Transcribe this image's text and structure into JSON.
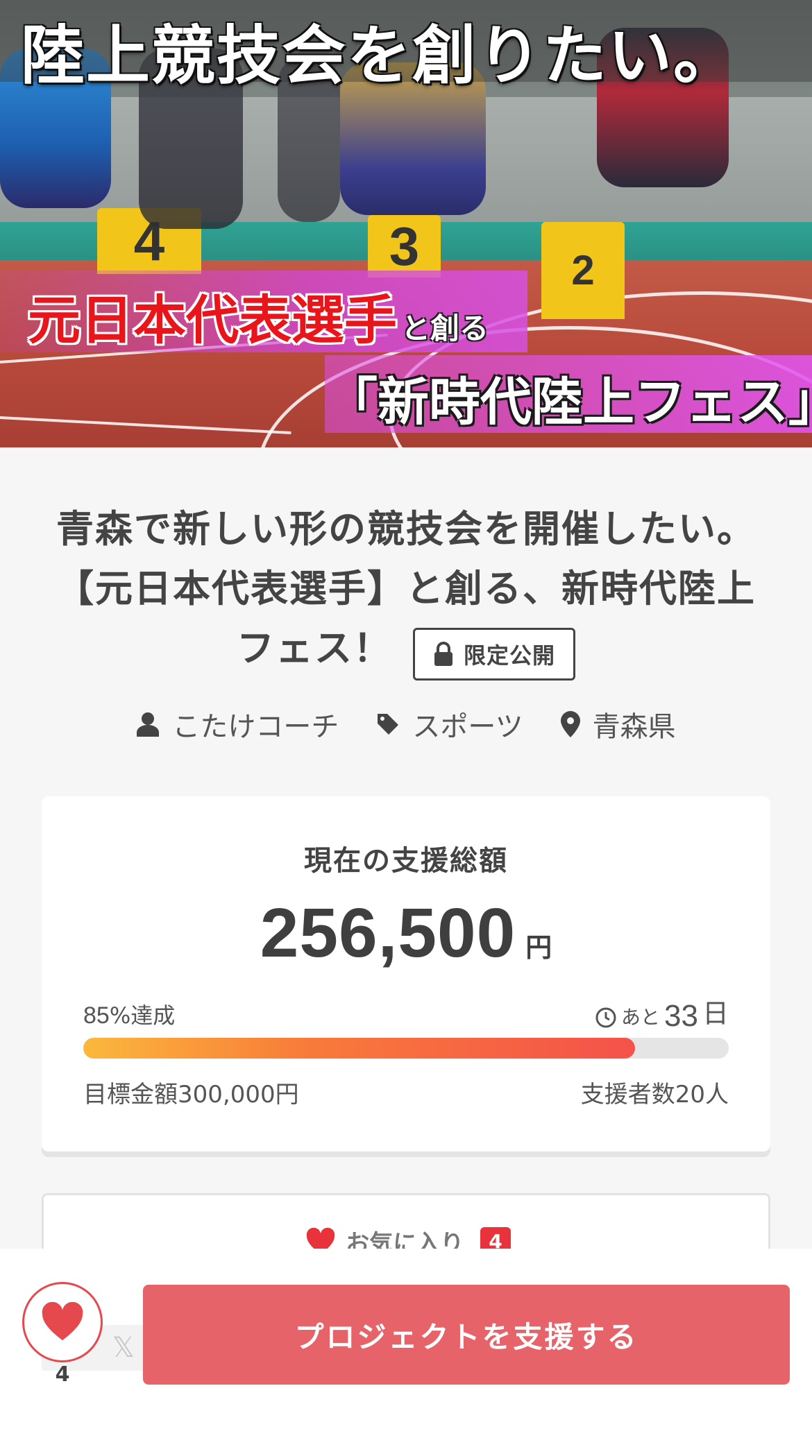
{
  "hero": {
    "headline": "陸上競技会を創りたい。",
    "sub_big": "元日本代表選手",
    "sub_small": "と創る",
    "fes": "「新時代陸上フェス」"
  },
  "project": {
    "title": "青森で新しい形の競技会を開催したい。【元日本代表選手】と創る、新時代陸上フェス！",
    "limited_label": "限定公開",
    "owner": "こたけコーチ",
    "category": "スポーツ",
    "location": "青森県"
  },
  "funding": {
    "label": "現在の支援総額",
    "amount": "256,500",
    "currency_unit": "円",
    "percent": "85",
    "percent_suffix": "%達成",
    "remaining_prefix": "あと",
    "remaining_days": "33",
    "remaining_unit": "日",
    "progress_fraction": 0.855,
    "goal_text": "目標金額300,000円",
    "backers_text": "支援者数20人"
  },
  "favorite": {
    "label": "お気に入り",
    "count": "4"
  },
  "bottom": {
    "fav_count": "4",
    "support_label": "プロジェクトを支援する"
  },
  "colors": {
    "accent": "#e7636a",
    "badge_red": "#e8323c",
    "progress_start": "#fbb83c",
    "progress_end": "#f4524a"
  },
  "icons": [
    "lock-icon",
    "user-icon",
    "tag-icon",
    "location-pin-icon",
    "clock-icon",
    "heart-icon"
  ]
}
